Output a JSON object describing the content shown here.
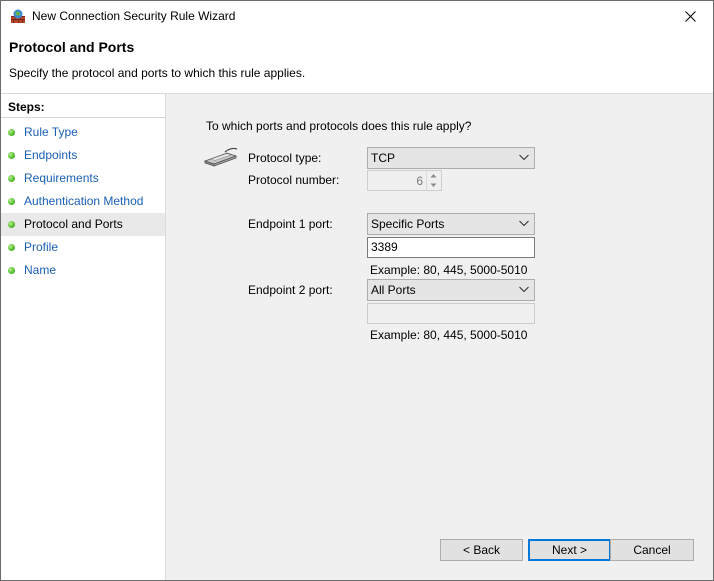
{
  "window": {
    "title": "New Connection Security Rule Wizard",
    "close_icon": "close-icon"
  },
  "header": {
    "title": "Protocol and Ports",
    "subtitle": "Specify the protocol and ports to which this rule applies."
  },
  "sidebar": {
    "heading": "Steps:",
    "current_index": 4,
    "items": [
      {
        "label": "Rule Type"
      },
      {
        "label": "Endpoints"
      },
      {
        "label": "Requirements"
      },
      {
        "label": "Authentication Method"
      },
      {
        "label": "Protocol and Ports"
      },
      {
        "label": "Profile"
      },
      {
        "label": "Name"
      }
    ]
  },
  "content": {
    "question": "To which ports and protocols does this rule apply?",
    "protocol_type": {
      "label": "Protocol type:",
      "value": "TCP"
    },
    "protocol_number": {
      "label": "Protocol number:",
      "value": "6"
    },
    "endpoint1": {
      "label": "Endpoint 1 port:",
      "value": "Specific Ports",
      "ports": "3389",
      "example": "Example: 80, 445, 5000-5010"
    },
    "endpoint2": {
      "label": "Endpoint 2 port:",
      "value": "All Ports",
      "ports": "",
      "example": "Example: 80, 445, 5000-5010"
    }
  },
  "buttons": {
    "back": "< Back",
    "next": "Next >",
    "cancel": "Cancel"
  },
  "colors": {
    "link": "#1a5fb4",
    "content_bg": "#f0f0f0",
    "accent": "#0078d7",
    "step_dot": "#58c032"
  }
}
